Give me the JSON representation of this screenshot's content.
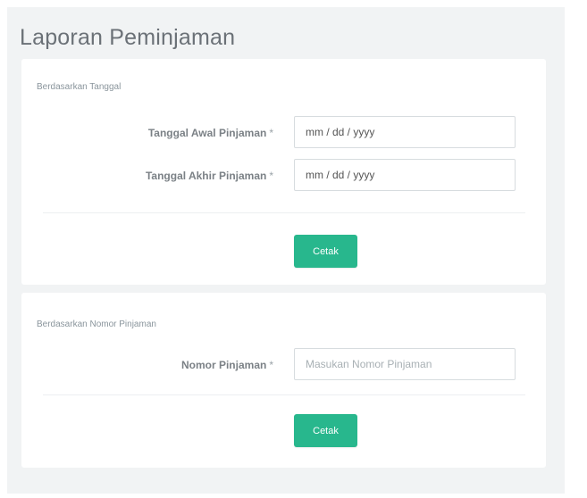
{
  "page": {
    "title": "Laporan Peminjaman"
  },
  "by_date": {
    "section_title": "Berdasarkan Tanggal",
    "start_label": "Tanggal Awal Pinjaman",
    "start_value": "mm / dd / yyyy",
    "end_label": "Tanggal Akhir Pinjaman",
    "end_value": "mm / dd / yyyy",
    "required_mark": "*",
    "submit_label": "Cetak"
  },
  "by_number": {
    "section_title": "Berdasarkan Nomor Pinjaman",
    "number_label": "Nomor Pinjaman",
    "number_placeholder": "Masukan Nomor Pinjaman",
    "required_mark": "*",
    "submit_label": "Cetak"
  },
  "colors": {
    "accent": "#28b78d",
    "background": "#f1f3f4",
    "card": "#ffffff"
  }
}
